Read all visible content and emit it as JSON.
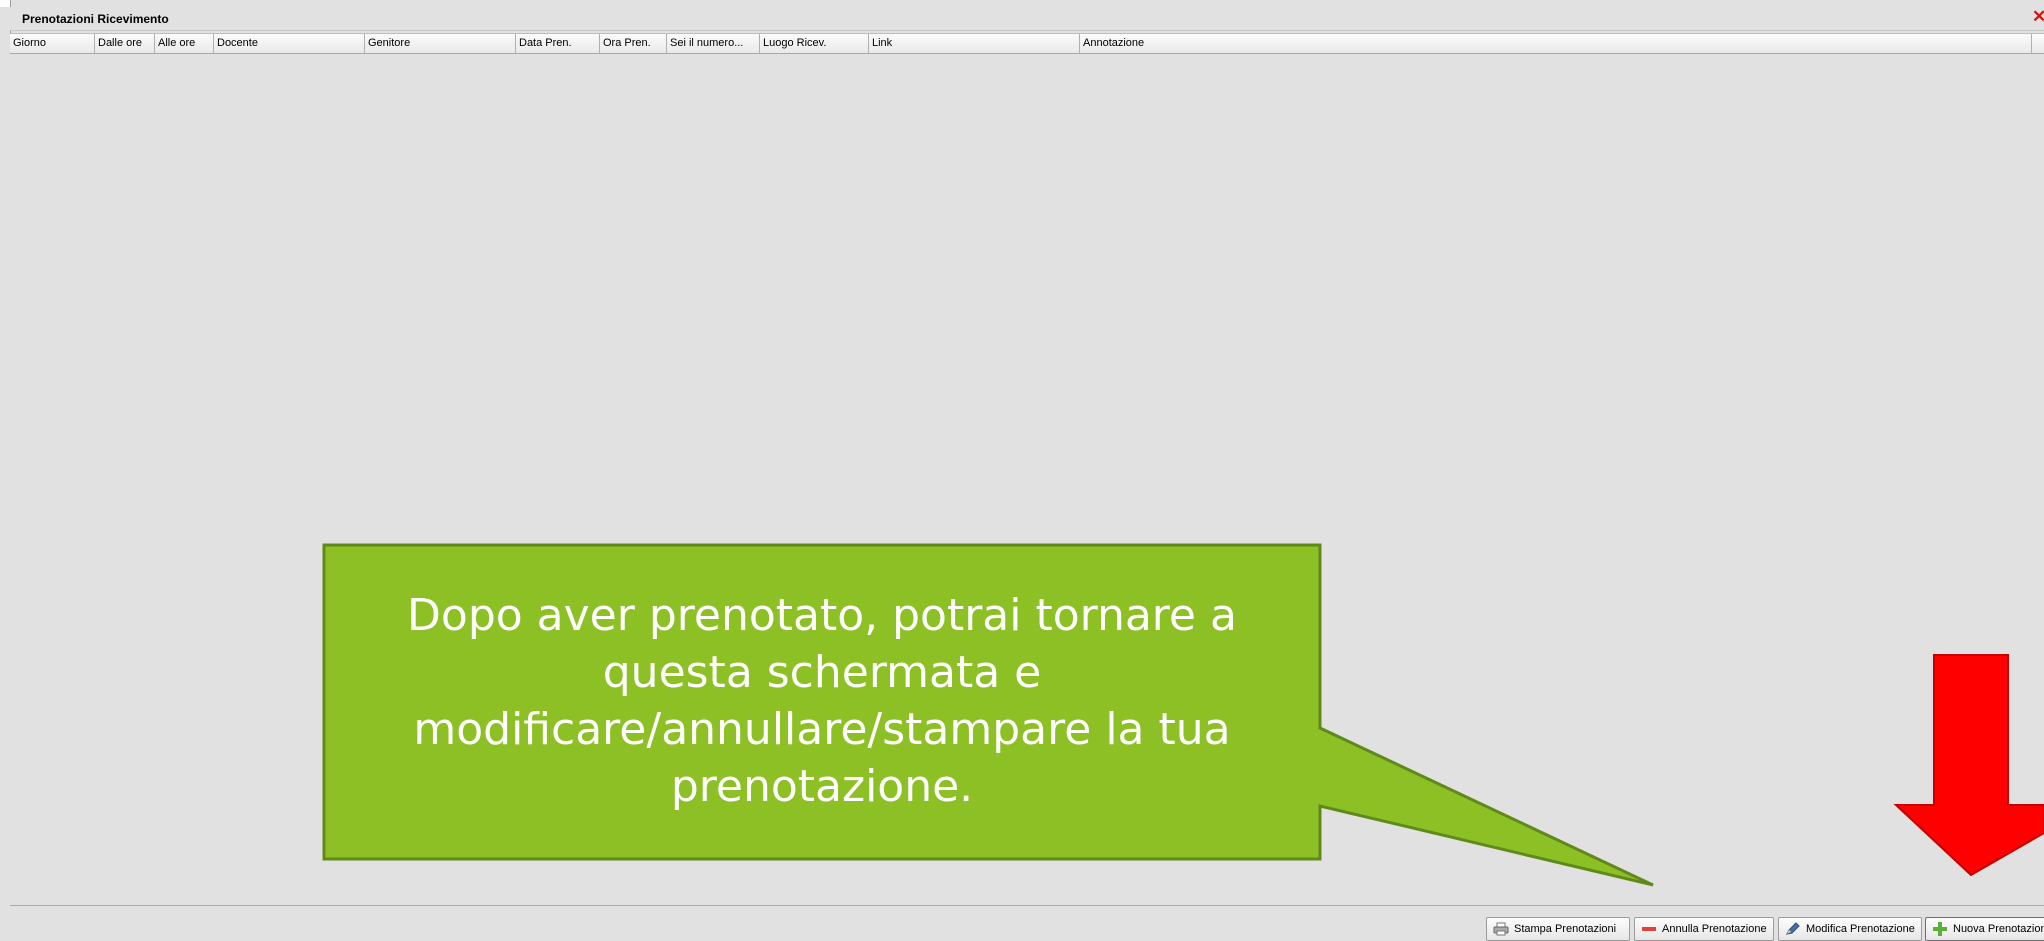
{
  "window": {
    "title": "Prenotazioni Ricevimento",
    "close_icon": "close-icon"
  },
  "table": {
    "columns": [
      "Giorno",
      "Dalle ore",
      "Alle ore",
      "Docente",
      "Genitore",
      "Data Pren.",
      "Ora Pren.",
      "Sei il numero...",
      "Luogo Ricev.",
      "Link",
      "Annotazione"
    ],
    "rows": []
  },
  "toolbar": {
    "print_label": "Stampa Prenotazioni",
    "cancel_label": "Annulla Prenotazione",
    "edit_label": "Modifica Prenotazione",
    "new_label": "Nuova Prenotazione"
  },
  "callout": {
    "text": "Dopo aver prenotato, potrai tornare a questa schermata e modificare/annullare/stampare la tua prenotazione."
  },
  "colors": {
    "callout_fill": "#8dc025",
    "callout_border": "#5f8a1a",
    "arrow": "#ff0000",
    "background": "#e1e1e1"
  }
}
